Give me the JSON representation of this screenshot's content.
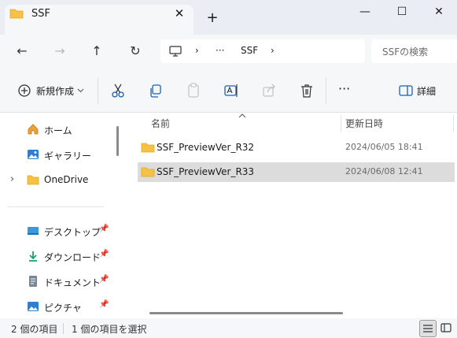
{
  "window": {
    "tab_title": "SSF",
    "tab_close": "✕",
    "new_tab": "+",
    "minimize": "—",
    "maximize": "☐",
    "close": "✕"
  },
  "nav": {
    "back": "←",
    "forward": "→",
    "up": "↑",
    "refresh": "↻",
    "address_more": "···",
    "address_chevron": "›",
    "current_folder": "SSF",
    "search_placeholder": "SSFの検索"
  },
  "toolbar": {
    "new_label": "新規作成",
    "more": "···",
    "details_label": "詳細"
  },
  "sidebar": {
    "items": [
      {
        "label": "ホーム",
        "icon": "home-icon"
      },
      {
        "label": "ギャラリー",
        "icon": "gallery-icon"
      },
      {
        "label": "OneDrive",
        "icon": "folder-icon"
      },
      {
        "label": "デスクトップ",
        "icon": "desktop-icon"
      },
      {
        "label": "ダウンロード",
        "icon": "download-icon"
      },
      {
        "label": "ドキュメント",
        "icon": "document-icon"
      },
      {
        "label": "ピクチャ",
        "icon": "pictures-icon"
      }
    ],
    "pin_glyph": "📌",
    "expand_glyph": "›"
  },
  "file_list": {
    "columns": [
      "名前",
      "更新日時"
    ],
    "rows": [
      {
        "name": "SSF_PreviewVer_R32",
        "date": "2024/06/05 18:41",
        "selected": false
      },
      {
        "name": "SSF_PreviewVer_R33",
        "date": "2024/06/08 12:41",
        "selected": true
      }
    ]
  },
  "status": {
    "item_count": "2 個の項目",
    "selected_count": "1 個の項目を選択"
  },
  "colors": {
    "folder": "#f3c247",
    "folder_dark": "#e6a817",
    "accent": "#0a64c8",
    "selected_row": "#dcdcdc"
  }
}
